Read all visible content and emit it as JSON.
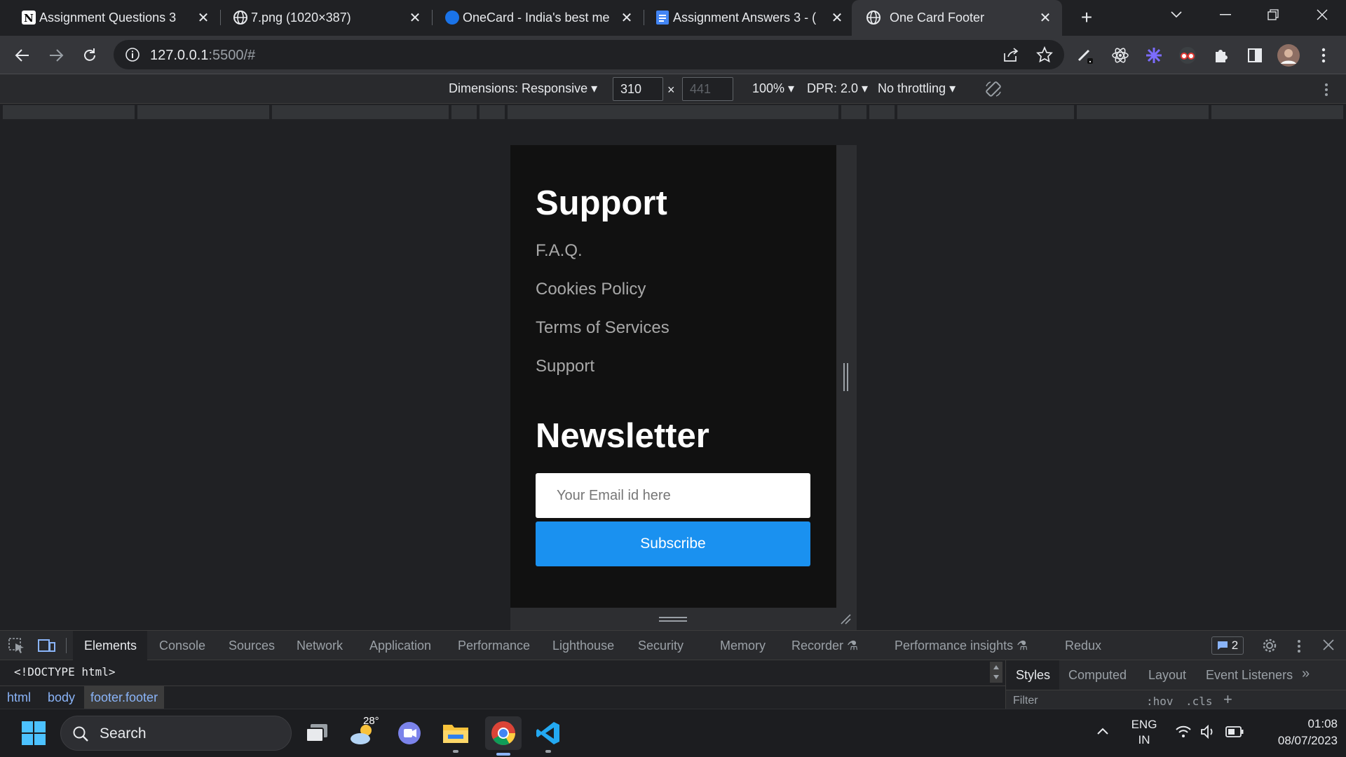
{
  "tabs": [
    {
      "title": "Assignment Questions 3",
      "icon": "notion-icon"
    },
    {
      "title": "7.png (1020×387)",
      "icon": "globe-icon"
    },
    {
      "title": "OneCard - India's best me",
      "icon": "onecard-icon"
    },
    {
      "title": "Assignment Answers 3 - (",
      "icon": "docs-icon"
    },
    {
      "title": "One Card Footer",
      "icon": "globe-icon",
      "active": true
    }
  ],
  "address": {
    "host": "127.0.0.1",
    "rest": ":5500/#"
  },
  "device_toolbar": {
    "dimensions_label": "Dimensions: Responsive",
    "width": "310",
    "height_placeholder": "441",
    "times": "×",
    "zoom": "100%",
    "dpr": "DPR: 2.0",
    "throttling": "No throttling"
  },
  "page": {
    "support_heading": "Support",
    "support_links": [
      "F.A.Q.",
      "Cookies Policy",
      "Terms of Services",
      "Support"
    ],
    "newsletter_heading": "Newsletter",
    "email_placeholder": "Your Email id here",
    "subscribe_label": "Subscribe"
  },
  "devtools": {
    "tabs": [
      "Elements",
      "Console",
      "Sources",
      "Network",
      "Application",
      "Performance",
      "Lighthouse",
      "Security",
      "Memory",
      "Recorder",
      "Performance insights",
      "Redux"
    ],
    "issues_count": "2",
    "doctype": "<!DOCTYPE html>",
    "breadcrumbs": [
      "html",
      "body",
      "footer.footer"
    ],
    "styles_tabs": [
      "Styles",
      "Computed",
      "Layout",
      "Event Listeners"
    ],
    "filter_placeholder": "Filter",
    "hov": ":hov",
    "cls": ".cls"
  },
  "taskbar": {
    "search_label": "Search",
    "weather": "28°",
    "lang_line1": "ENG",
    "lang_line2": "IN",
    "time": "01:08",
    "date": "08/07/2023"
  },
  "colors": {
    "accent_blue": "#1a91f0",
    "page_bg": "#111111",
    "link_gray": "#a8a8a8"
  }
}
